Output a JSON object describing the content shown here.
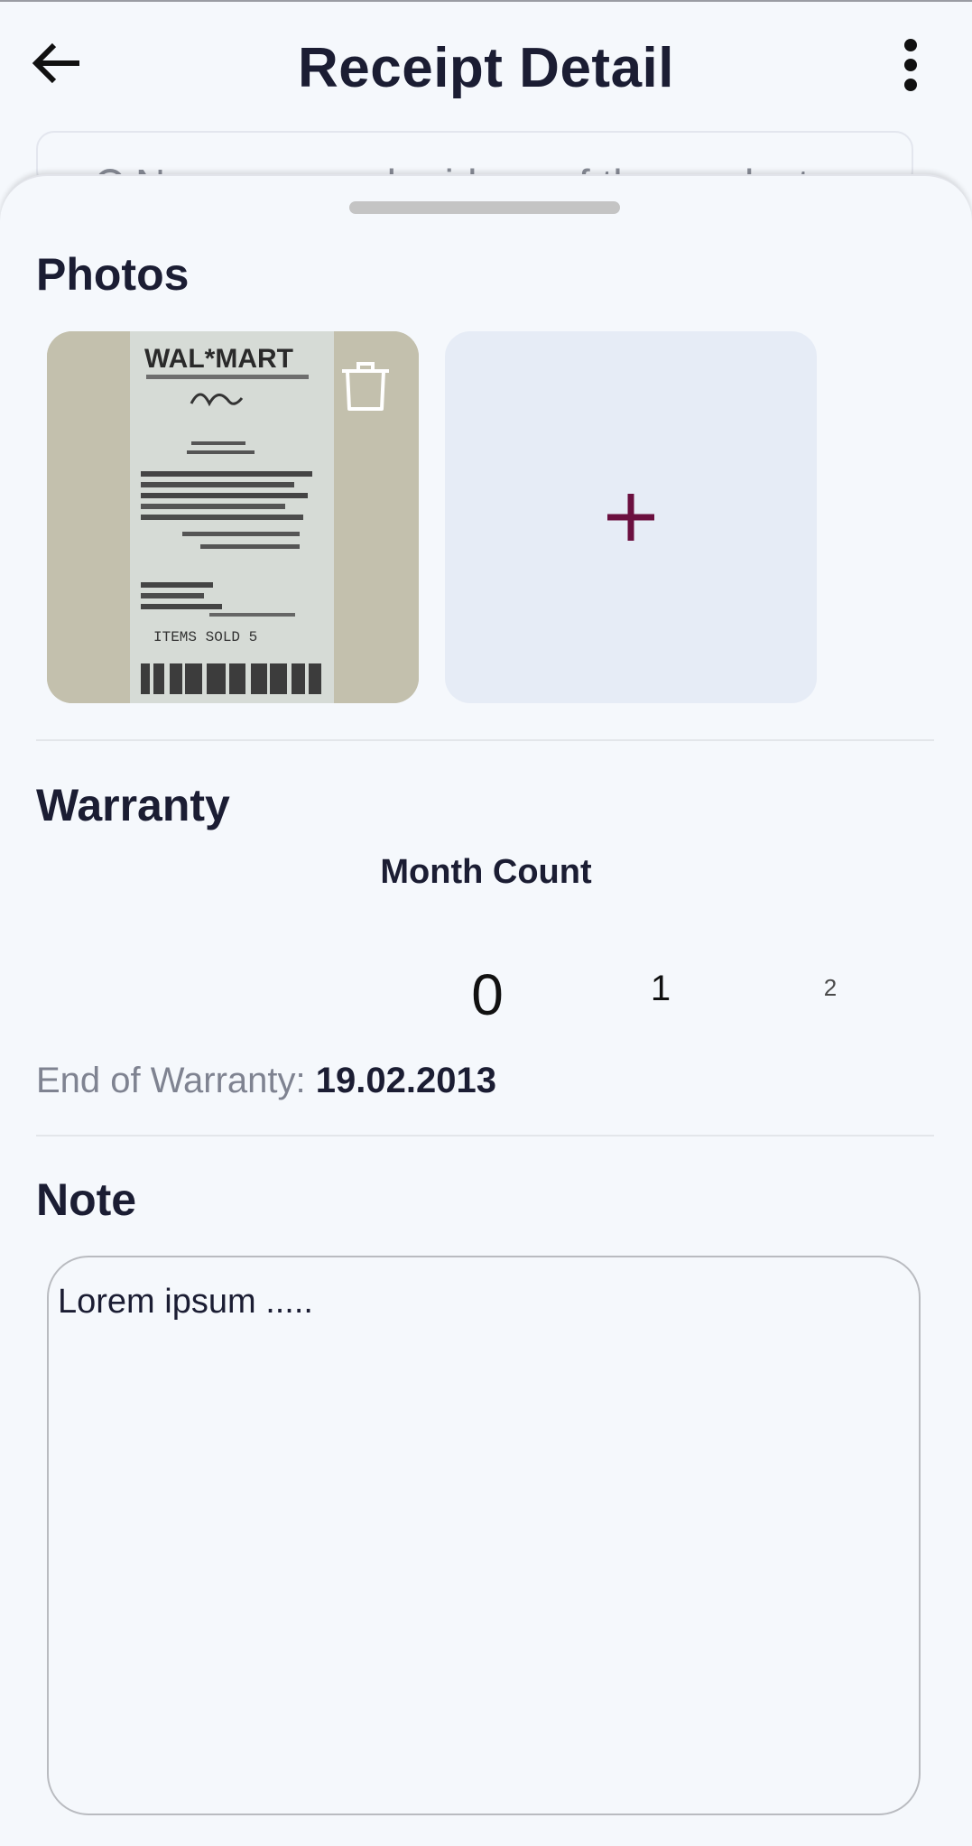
{
  "app_bar": {
    "title": "Receipt Detail",
    "back_icon": "arrow-left-icon",
    "menu_icon": "more-vert-icon"
  },
  "search": {
    "peek_text": "Name or vendor ideas of the product",
    "icon": "search-icon"
  },
  "sheet": {
    "photos": {
      "heading": "Photos",
      "items": [
        {
          "type": "receipt-photo",
          "store_text": "WAL*MART",
          "footer_text": "ITEMS SOLD 5"
        }
      ],
      "delete_icon": "trash-icon",
      "add_icon": "plus-icon"
    },
    "warranty": {
      "heading": "Warranty",
      "month_count_label": "Month Count",
      "picker_values": [
        "0",
        "1",
        "2"
      ],
      "selected_index": 0,
      "end_label": "End of Warranty: ",
      "end_date": "19.02.2013"
    },
    "note": {
      "heading": "Note",
      "text": "Lorem ipsum ....."
    }
  },
  "colors": {
    "background": "#f5f8fc",
    "add_tile": "#e6ecf6",
    "accent_plus": "#6b0f3f",
    "text_primary": "#1b1d33",
    "text_muted": "#7f8391"
  }
}
